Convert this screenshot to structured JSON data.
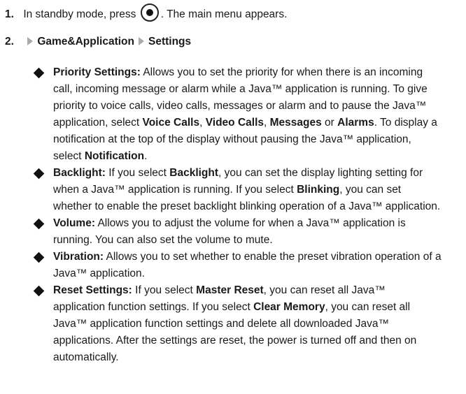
{
  "step1": {
    "number": "1.",
    "text_before": "In standby mode, press",
    "key_icon": "center-select-key-icon",
    "text_after": ". The main menu appears."
  },
  "step2": {
    "number": "2.",
    "path": [
      "Game&Application",
      "Settings"
    ]
  },
  "items": [
    {
      "lines": [
        [
          {
            "t": "Priority Settings:",
            "b": true
          },
          {
            "t": " Allows you to set the priority for when there is an incoming"
          }
        ],
        [
          {
            "t": "call, incoming message or alarm while a Java™ application is running. To give"
          }
        ],
        [
          {
            "t": "priority to voice calls, video calls, messages or alarm and to pause the Java™"
          }
        ],
        [
          {
            "t": "application, select "
          },
          {
            "t": "Voice Calls",
            "b": true
          },
          {
            "t": ", "
          },
          {
            "t": "Video Calls",
            "b": true
          },
          {
            "t": ", "
          },
          {
            "t": "Messages",
            "b": true
          },
          {
            "t": " or "
          },
          {
            "t": "Alarms",
            "b": true
          },
          {
            "t": ". To display a"
          }
        ],
        [
          {
            "t": "notification at the top of the display without pausing the Java™ application,"
          }
        ],
        [
          {
            "t": "select "
          },
          {
            "t": "Notification",
            "b": true
          },
          {
            "t": "."
          }
        ]
      ]
    },
    {
      "lines": [
        [
          {
            "t": "Backlight:",
            "b": true
          },
          {
            "t": " If you select "
          },
          {
            "t": "Backlight",
            "b": true
          },
          {
            "t": ", you can set the display lighting setting for"
          }
        ],
        [
          {
            "t": "when a Java™ application is running. If you select "
          },
          {
            "t": "Blinking",
            "b": true
          },
          {
            "t": ", you can set"
          }
        ],
        [
          {
            "t": "whether to enable the preset backlight blinking operation of a Java™ application."
          }
        ]
      ]
    },
    {
      "lines": [
        [
          {
            "t": "Volume:",
            "b": true
          },
          {
            "t": " Allows you to adjust the volume for when a Java™ application is"
          }
        ],
        [
          {
            "t": "running. You can also set the volume to mute."
          }
        ]
      ]
    },
    {
      "lines": [
        [
          {
            "t": "Vibration:",
            "b": true
          },
          {
            "t": " Allows you to set whether to enable the preset vibration operation of a"
          }
        ],
        [
          {
            "t": "Java™ application."
          }
        ]
      ]
    },
    {
      "lines": [
        [
          {
            "t": "Reset Settings:",
            "b": true
          },
          {
            "t": " If you select "
          },
          {
            "t": "Master Reset",
            "b": true
          },
          {
            "t": ", you can reset all Java™"
          }
        ],
        [
          {
            "t": "application function settings. If you select "
          },
          {
            "t": "Clear Memory",
            "b": true
          },
          {
            "t": ", you can reset all"
          }
        ],
        [
          {
            "t": "Java™ application function settings and delete all downloaded Java™"
          }
        ],
        [
          {
            "t": "applications. After the settings are reset, the power is turned off and then on"
          }
        ],
        [
          {
            "t": "automatically."
          }
        ]
      ]
    }
  ]
}
